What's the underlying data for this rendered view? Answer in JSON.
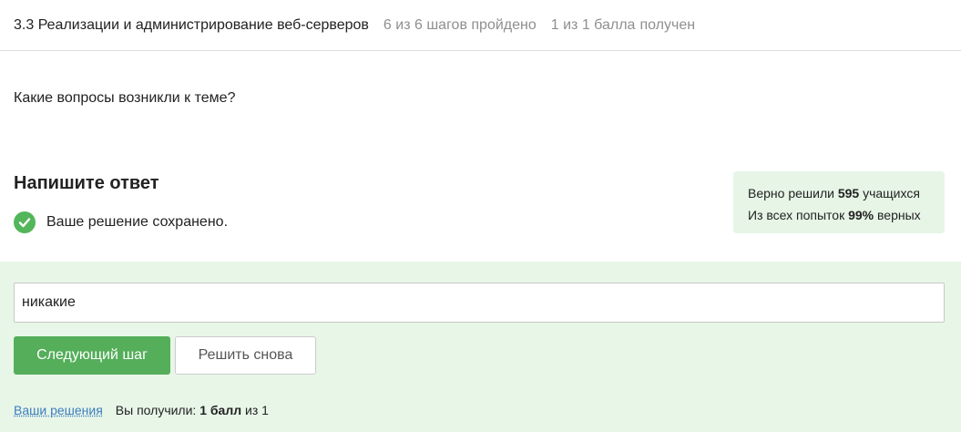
{
  "header": {
    "title": "3.3 Реализации и администрирование веб-серверов",
    "steps": "6 из 6 шагов пройдено",
    "score": "1 из 1 балла",
    "score_status": "получен"
  },
  "question": {
    "text": "Какие вопросы возникли к теме?"
  },
  "answer": {
    "heading": "Напишите ответ",
    "saved_text": "Ваше решение сохранено.",
    "value": "никакие"
  },
  "stats": {
    "solved_prefix": "Верно решили",
    "solved_count": "595",
    "solved_suffix": "учащихся",
    "attempts_prefix": "Из всех попыток",
    "attempts_percent": "99%",
    "attempts_suffix": "верных"
  },
  "buttons": {
    "next_label": "Следующий шаг",
    "retry_label": "Решить снова"
  },
  "footer": {
    "solutions_link": "Ваши решения",
    "received_prefix": "Вы получили:",
    "received_points": "1 балл",
    "received_suffix": "из 1"
  },
  "colors": {
    "accent_green": "#54ae5a",
    "panel_green": "#e8f6e8",
    "link_blue": "#3b7dbf"
  },
  "icons": {
    "saved": "check-circle-icon"
  }
}
